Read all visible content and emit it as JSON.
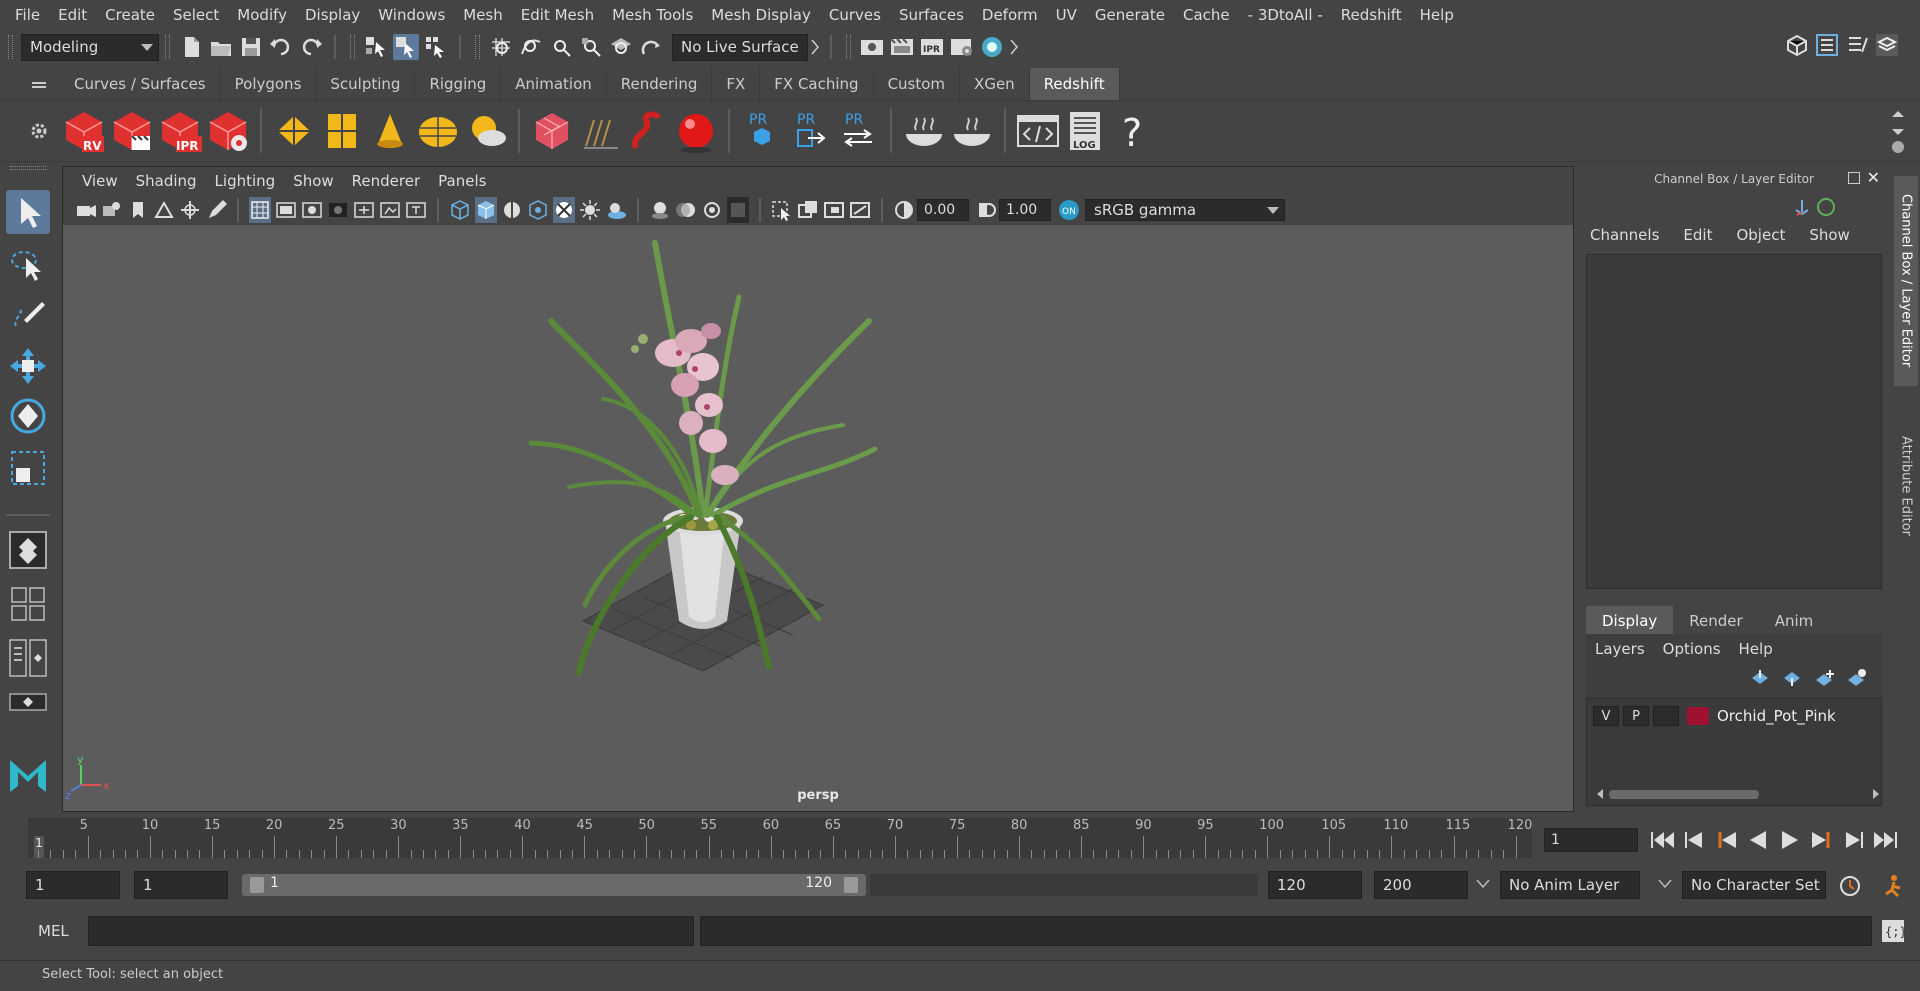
{
  "menubar": [
    "File",
    "Edit",
    "Create",
    "Select",
    "Modify",
    "Display",
    "Windows",
    "Mesh",
    "Edit Mesh",
    "Mesh Tools",
    "Mesh Display",
    "Curves",
    "Surfaces",
    "Deform",
    "UV",
    "Generate",
    "Cache",
    "- 3DtoAll -",
    "Redshift",
    "Help"
  ],
  "status": {
    "mode": "Modeling",
    "live_surface": "No Live Surface"
  },
  "shelf": {
    "tabs": [
      "Curves / Surfaces",
      "Polygons",
      "Sculpting",
      "Rigging",
      "Animation",
      "Rendering",
      "FX",
      "FX Caching",
      "Custom",
      "XGen",
      "Redshift"
    ],
    "active_tab": "Redshift",
    "labels": {
      "rv": "RV",
      "ipr": "IPR",
      "pr": "PR",
      "log": "LOG",
      "help": "?"
    }
  },
  "viewport": {
    "menu": [
      "View",
      "Shading",
      "Lighting",
      "Show",
      "Renderer",
      "Panels"
    ],
    "exposure": "0.00",
    "gamma": "1.00",
    "color_space": "sRGB gamma",
    "camera": "persp",
    "axis": {
      "x": "x",
      "y": "y",
      "z": "z"
    }
  },
  "channel_box": {
    "title": "Channel Box / Layer Editor",
    "menu": [
      "Channels",
      "Edit",
      "Object",
      "Show"
    ]
  },
  "layer_editor": {
    "tabs": [
      "Display",
      "Render",
      "Anim"
    ],
    "active_tab": "Display",
    "menu": [
      "Layers",
      "Options",
      "Help"
    ],
    "layer": {
      "v": "V",
      "p": "P",
      "name": "Orchid_Pot_Pink",
      "color": "#a01030"
    }
  },
  "side_tabs": [
    "Channel Box / Layer Editor",
    "Attribute Editor"
  ],
  "timeline": {
    "ticks": [
      5,
      10,
      15,
      20,
      25,
      30,
      35,
      40,
      45,
      50,
      55,
      60,
      65,
      70,
      75,
      80,
      85,
      90,
      95,
      100,
      105,
      110,
      115,
      120
    ],
    "current_frame": "1",
    "current_field": "1"
  },
  "range": {
    "start": "1",
    "playback_start": "1",
    "slider_start": "1",
    "slider_end": "120",
    "playback_end": "120",
    "end": "200",
    "anim_layer": "No Anim Layer",
    "character_set": "No Character Set"
  },
  "command": {
    "lang": "MEL"
  },
  "help_line": "Select Tool: select an object"
}
